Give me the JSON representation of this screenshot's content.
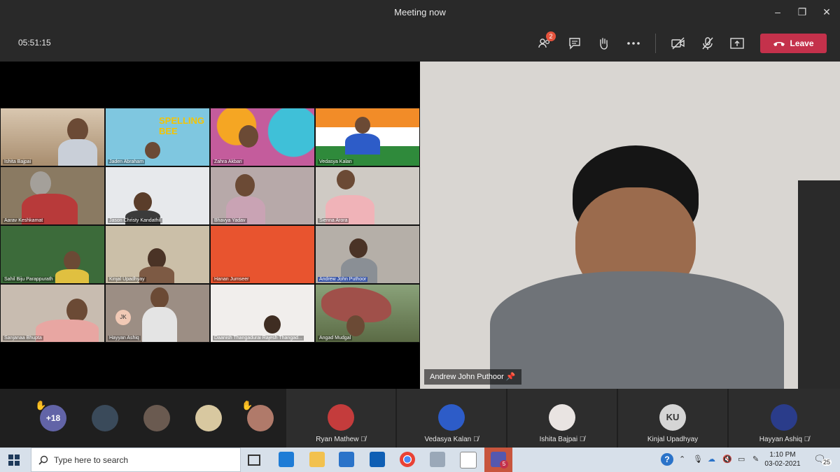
{
  "window": {
    "title": "Meeting now",
    "minimize": "–",
    "maximize": "❐",
    "close": "✕"
  },
  "toolbar": {
    "timer": "05:51:15",
    "participants_badge": "2",
    "leave_label": "Leave"
  },
  "grid": {
    "tiles": [
      {
        "name": "Ishita Bajpai"
      },
      {
        "name": "Jaden Abraham",
        "banner": "SPELLING BEE"
      },
      {
        "name": "Zahra Akbari"
      },
      {
        "name": "Vedasya Kalan"
      },
      {
        "name": "Aarav Keshkamat"
      },
      {
        "name": "Jason Christy Kandathil"
      },
      {
        "name": "Bhavya Yadav"
      },
      {
        "name": "Sienna Arora"
      },
      {
        "name": "Sahil Biju Parappurath"
      },
      {
        "name": "Kinjal Upadhyay"
      },
      {
        "name": "Hanan Jumseer"
      },
      {
        "name": "Andrew John Puthoor"
      },
      {
        "name": "Sanjanaa Bhupta"
      },
      {
        "name": "Hayyan Ashiq",
        "initials": "JK"
      },
      {
        "name": "Daanish Thangadurai Rajesh Thangad..."
      },
      {
        "name": "Angad Mudgal"
      }
    ]
  },
  "main_video": {
    "name": "Andrew John Puthoor"
  },
  "strip": {
    "overflow": "+18",
    "participants": [
      {
        "name": "Ryan Mathew"
      },
      {
        "name": "Vedasya Kalan"
      },
      {
        "name": "Ishita Bajpai"
      },
      {
        "name": "Kinjal Upadhyay",
        "initials": "KU"
      },
      {
        "name": "Hayyan Ashiq"
      }
    ]
  },
  "taskbar": {
    "search_placeholder": "Type here to search",
    "time": "1:10 PM",
    "date": "03-02-2021",
    "notif_count": "25",
    "teams_badge": "5"
  }
}
